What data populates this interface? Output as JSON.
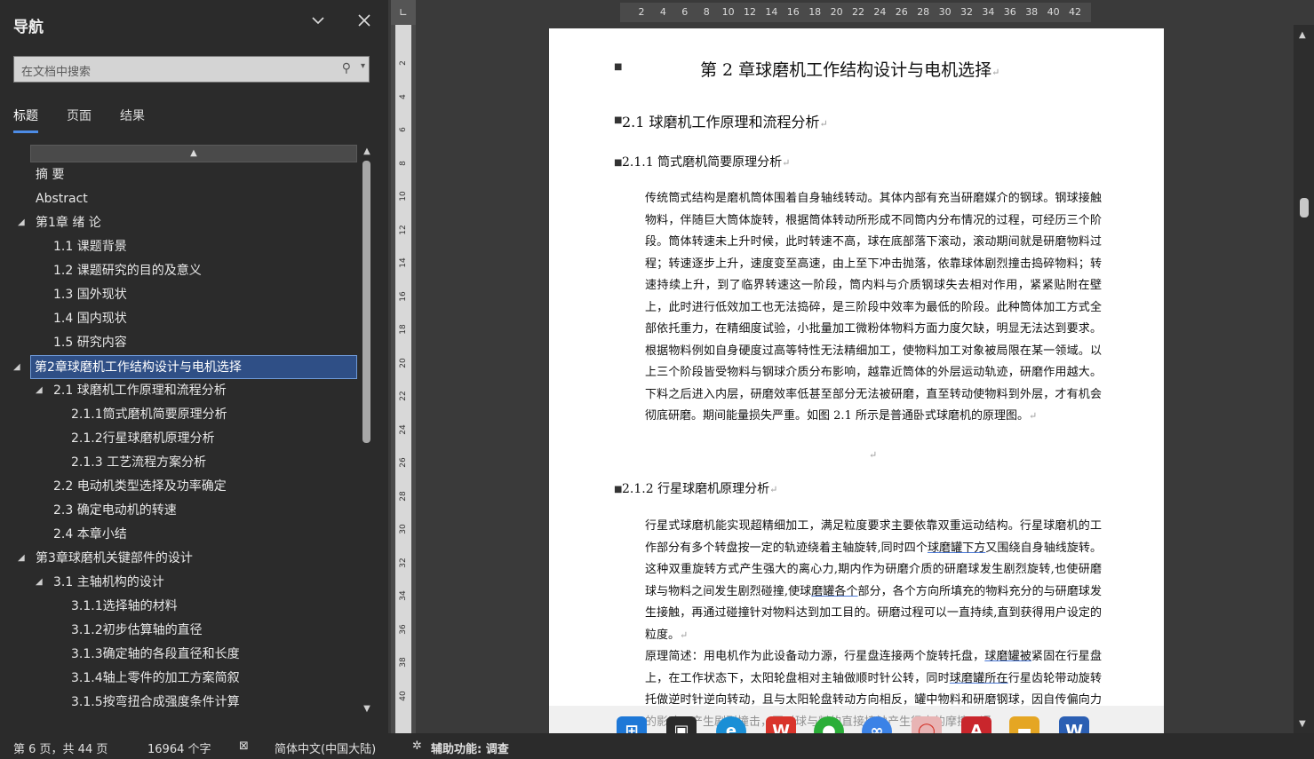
{
  "nav": {
    "title": "导航",
    "search_placeholder": "在文档中搜索",
    "tabs": [
      "标题",
      "页面",
      "结果"
    ],
    "active_tab": "标题",
    "tree": [
      {
        "label": "摘  要",
        "level": 0,
        "expander": ""
      },
      {
        "label": "Abstract",
        "level": 0,
        "expander": ""
      },
      {
        "label": "第1章 绪  论",
        "level": 0,
        "expander": "◢"
      },
      {
        "label": "1.1 课题背景",
        "level": 1,
        "expander": ""
      },
      {
        "label": "1.2 课题研究的目的及意义",
        "level": 1,
        "expander": ""
      },
      {
        "label": "1.3 国外现状",
        "level": 1,
        "expander": ""
      },
      {
        "label": "1.4 国内现状",
        "level": 1,
        "expander": ""
      },
      {
        "label": "1.5 研究内容",
        "level": 1,
        "expander": ""
      },
      {
        "label": "第2章球磨机工作结构设计与电机选择",
        "level": 0,
        "expander": "◢",
        "selected": true
      },
      {
        "label": "2.1 球磨机工作原理和流程分析",
        "level": 1,
        "expander": "◢"
      },
      {
        "label": "2.1.1筒式磨机简要原理分析",
        "level": 2,
        "expander": ""
      },
      {
        "label": "2.1.2行星球磨机原理分析",
        "level": 2,
        "expander": ""
      },
      {
        "label": "2.1.3 工艺流程方案分析",
        "level": 2,
        "expander": ""
      },
      {
        "label": "2.2 电动机类型选择及功率确定",
        "level": 1,
        "expander": ""
      },
      {
        "label": "2.3 确定电动机的转速",
        "level": 1,
        "expander": ""
      },
      {
        "label": "2.4 本章小结",
        "level": 1,
        "expander": ""
      },
      {
        "label": "第3章球磨机关键部件的设计",
        "level": 0,
        "expander": "◢"
      },
      {
        "label": "3.1 主轴机构的设计",
        "level": 1,
        "expander": "◢"
      },
      {
        "label": "3.1.1选择轴的材料",
        "level": 2,
        "expander": ""
      },
      {
        "label": "3.1.2初步估算轴的直径",
        "level": 2,
        "expander": ""
      },
      {
        "label": "3.1.3确定轴的各段直径和长度",
        "level": 2,
        "expander": ""
      },
      {
        "label": "3.1.4轴上零件的加工方案简叙",
        "level": 2,
        "expander": ""
      },
      {
        "label": "3.1.5按弯扭合成强度条件计算",
        "level": 2,
        "expander": ""
      }
    ]
  },
  "rulers": {
    "horizontal": [
      "2",
      "4",
      "6",
      "8",
      "10",
      "12",
      "14",
      "16",
      "18",
      "20",
      "22",
      "24",
      "26",
      "28",
      "30",
      "32",
      "34",
      "36",
      "38",
      "40",
      "42"
    ],
    "vertical": [
      "2",
      "4",
      "6",
      "8",
      "10",
      "12",
      "14",
      "16",
      "18",
      "20",
      "22",
      "24",
      "26",
      "28",
      "30",
      "32",
      "34",
      "36",
      "38",
      "40"
    ]
  },
  "document": {
    "chapter_title": "第 2 章球磨机工作结构设计与电机选择",
    "h2": "2.1 球磨机工作原理和流程分析",
    "h3a": "2.1.1 筒式磨机简要原理分析",
    "para1": "传统筒式结构是磨机筒体围着自身轴线转动。其体内部有充当研磨媒介的钢球。钢球接触物料，伴随巨大筒体旋转，根据筒体转动所形成不同筒内分布情况的过程，可经历三个阶段。筒体转速未上升时候，此时转速不高，球在底部落下滚动，滚动期间就是研磨物料过程；转速逐步上升，速度变至高速，由上至下冲击抛落，依靠球体剧烈撞击捣碎物料；转速持续上升，到了临界转速这一阶段，筒内料与介质钢球失去相对作用，紧紧贴附在壁上，此时进行低效加工也无法捣碎，是三阶段中效率为最低的阶段。此种筒体加工方式全部依托重力，在精细度试验，小批量加工微粉体物料方面力度欠缺，明显无法达到要求。根据物料例如自身硬度过高等特性无法精细加工，使物料加工对象被局限在某一领域。以上三个阶段皆受物料与钢球介质分布影响，越靠近筒体的外层运动轨迹，研磨作用越大。下料之后进入内层，研磨效率低甚至部分无法被研磨，直至转动使物料到外层，才有机会彻底研磨。期间能量损失严重。如图 2.1 所示是普通卧式球磨机的原理图。",
    "h3b": "2.1.2 行星球磨机原理分析",
    "para2_a": "行星式球磨机能实现超精细加工，满足粒度要求主要依靠双重运动结构。行星球磨机的工作部分有多个转盘按一定的轨迹绕着主轴旋转,同时四个",
    "para2_u1": "球磨罐下方",
    "para2_b": "又围绕自身轴线旋转。这种双重旋转方式产生强大的离心力,期内作为研磨介质的研磨球发生剧烈旋转,也使研磨球与物料之间发生剧烈碰撞,使球",
    "para2_u2": "磨罐各个",
    "para2_c": "部分，各个方向所填充的物料充分的与研磨球发生接触，再通过碰撞针对物料达到加工目的。研磨过程可以一直持续,直到获得用户设定的粒度。",
    "para3_a": "原理简述：用电机作为此设备动力源，行星盘连接两个旋转托盘，",
    "para3_u1": "球磨罐被",
    "para3_b": "紧固在行星盘上，在工作状态下，太阳轮盘相对主轴做顺时针公转，同时",
    "para3_u2": "球磨罐所在",
    "para3_c": "行星齿轮带动旋转托做逆时针逆向转动，且与太阳轮盘转动方向相反，罐中物料和研磨钢球，因自传偏向力的影响，产生剧烈撞击，同时球与料的直接接触产生很大的摩擦，通"
  },
  "taskbar": {
    "icons": [
      "windows-start-icon",
      "terminal-app-icon",
      "edge-browser-icon",
      "wps-app-icon",
      "wechat-app-icon",
      "baidu-netdisk-icon",
      "search-app-icon",
      "acrobat-app-icon",
      "file-explorer-icon",
      "word-app-icon"
    ]
  },
  "status": {
    "page": "第 6 页，共 44 页",
    "words": "16964 个字",
    "language": "简体中文(中国大陆)",
    "accessibility": "辅助功能: 调查"
  },
  "colors": {
    "nav_bg": "#2b2b2b",
    "selection": "#2f4f86",
    "accent": "#4d8ce6"
  }
}
